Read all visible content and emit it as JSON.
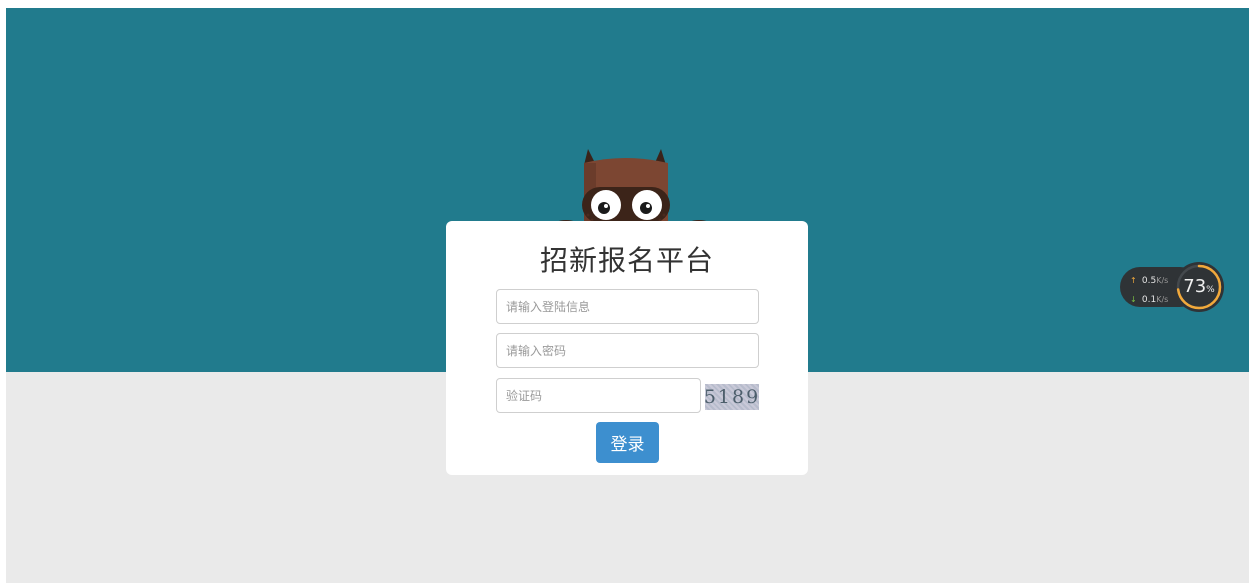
{
  "login": {
    "title": "招新报名平台",
    "username_placeholder": "请输入登陆信息",
    "password_placeholder": "请输入密码",
    "captcha_placeholder": "验证码",
    "captcha_text": "5189",
    "submit_label": "登录"
  },
  "net_monitor": {
    "upload_value": "0.5",
    "upload_unit": "K/s",
    "download_value": "0.1",
    "download_unit": "K/s",
    "usage_percent": 73,
    "usage_label": "73",
    "percent_sign": "%"
  },
  "icons": {
    "mascot": "owl-mascot-icon",
    "upload": "arrow-up-icon",
    "download": "arrow-down-icon"
  },
  "colors": {
    "banner": "#217b8d",
    "page_background": "#eaeaea",
    "card": "#ffffff",
    "button": "#3d8fcf",
    "upload_arrow": "#f2a93b",
    "download_arrow": "#79c043"
  }
}
